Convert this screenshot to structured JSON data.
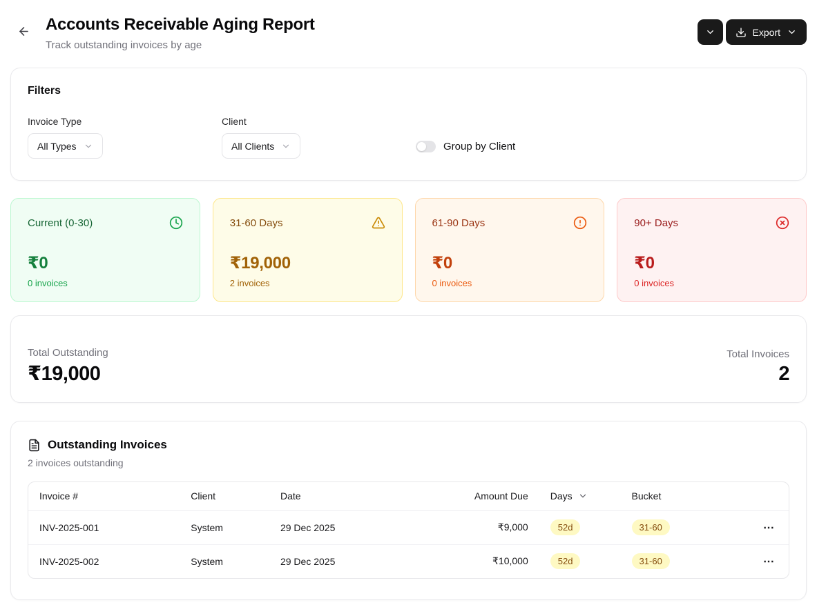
{
  "header": {
    "title": "Accounts Receivable Aging Report",
    "subtitle": "Track outstanding invoices by age",
    "export_label": "Export",
    "button_bg": "#1a1a1a"
  },
  "filters": {
    "title": "Filters",
    "invoice_type": {
      "label": "Invoice Type",
      "value": "All Types"
    },
    "client": {
      "label": "Client",
      "value": "All Clients"
    },
    "group_by_client": {
      "label": "Group by Client",
      "on": false
    }
  },
  "buckets": [
    {
      "label": "Current (0-30)",
      "value": "₹0",
      "count": "0 invoices",
      "icon": "clock-icon",
      "colors": {
        "bg": "#f0fdf4",
        "border": "#bbf7d0",
        "title": "#166534",
        "icon": "#16a34a",
        "value": "#15803d",
        "count": "#16a34a"
      }
    },
    {
      "label": "31-60 Days",
      "value": "₹19,000",
      "count": "2 invoices",
      "icon": "alert-triangle-icon",
      "colors": {
        "bg": "#fefce8",
        "border": "#fde68a",
        "title": "#854d0e",
        "icon": "#ca8a04",
        "value": "#a16207",
        "count": "#a16207"
      }
    },
    {
      "label": "61-90 Days",
      "value": "₹0",
      "count": "0 invoices",
      "icon": "alert-circle-icon",
      "colors": {
        "bg": "#fff7ed",
        "border": "#fed7aa",
        "title": "#9a3412",
        "icon": "#ea580c",
        "value": "#c2410c",
        "count": "#ea580c"
      }
    },
    {
      "label": "90+ Days",
      "value": "₹0",
      "count": "0 invoices",
      "icon": "x-circle-icon",
      "colors": {
        "bg": "#fef2f2",
        "border": "#fecaca",
        "title": "#991b1b",
        "icon": "#dc2626",
        "value": "#b91c1c",
        "count": "#dc2626"
      }
    }
  ],
  "totals": {
    "outstanding_label": "Total Outstanding",
    "outstanding_value": "₹19,000",
    "invoices_label": "Total Invoices",
    "invoices_value": "2"
  },
  "invoices_section": {
    "title": "Outstanding Invoices",
    "subtitle": "2 invoices outstanding",
    "columns": {
      "invoice": "Invoice #",
      "client": "Client",
      "date": "Date",
      "amount": "Amount Due",
      "days": "Days",
      "bucket": "Bucket"
    },
    "badge_colors": {
      "bg": "#fef9c3",
      "fg": "#854d0e"
    },
    "rows": [
      {
        "invoice": "INV-2025-001",
        "client": "System",
        "date": "29 Dec 2025",
        "amount": "₹9,000",
        "days": "52d",
        "bucket": "31-60",
        "menu": "⋯"
      },
      {
        "invoice": "INV-2025-002",
        "client": "System",
        "date": "29 Dec 2025",
        "amount": "₹10,000",
        "days": "52d",
        "bucket": "31-60",
        "menu": "⋯"
      }
    ]
  }
}
